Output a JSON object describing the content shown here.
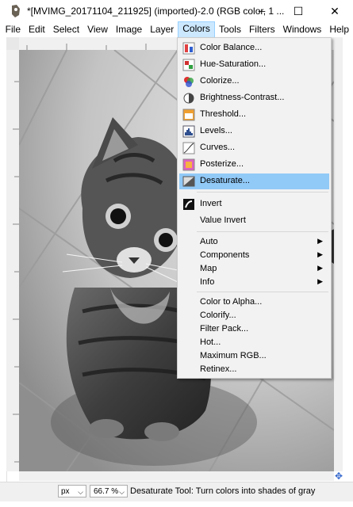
{
  "window": {
    "title": "*[MVIMG_20171104_211925] (imported)-2.0 (RGB color, 1 ...",
    "minimize": "─",
    "maximize": "☐",
    "close": "✕"
  },
  "menubar": {
    "items": [
      "File",
      "Edit",
      "Select",
      "View",
      "Image",
      "Layer",
      "Colors",
      "Tools",
      "Filters",
      "Windows",
      "Help"
    ],
    "active": "Colors"
  },
  "colors_menu": {
    "groups": [
      [
        "Color Balance...",
        "Hue-Saturation...",
        "Colorize...",
        "Brightness-Contrast...",
        "Threshold...",
        "Levels...",
        "Curves...",
        "Posterize...",
        "Desaturate..."
      ],
      [
        "Invert",
        "Value Invert"
      ],
      [
        "Auto",
        "Components",
        "Map",
        "Info"
      ],
      [
        "Color to Alpha...",
        "Colorify...",
        "Filter Pack...",
        "Hot...",
        "Maximum RGB...",
        "Retinex..."
      ]
    ],
    "highlighted": "Desaturate...",
    "submenu_arrow": "▶"
  },
  "status": {
    "unit": "px",
    "zoom": "66.7 %",
    "message": "Desaturate Tool: Turn colors into shades of gray"
  },
  "colors": {
    "highlight": "#91c9f7",
    "menubar_active": "#cce8ff"
  }
}
